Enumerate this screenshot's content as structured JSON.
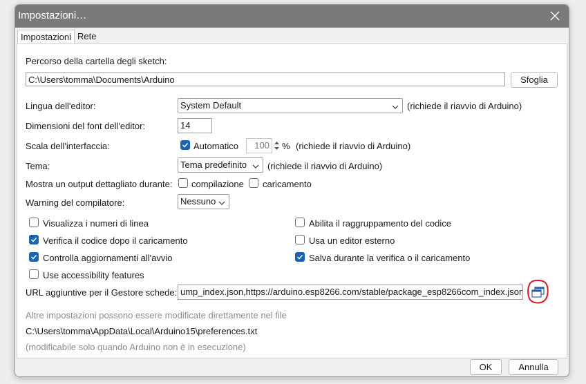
{
  "window": {
    "title": "Impostazioni…"
  },
  "tabs": [
    "Impostazioni",
    "Rete"
  ],
  "sketchbook": {
    "label": "Percorso della cartella degli sketch:",
    "value": "C:\\Users\\tomma\\Documents\\Arduino",
    "browse_label": "Sfoglia"
  },
  "language": {
    "label": "Lingua dell'editor:",
    "selected": "System Default",
    "note": "(richiede il riavvio di Arduino)"
  },
  "font_size": {
    "label": "Dimensioni del font dell'editor:",
    "value": "14"
  },
  "scale": {
    "label": "Scala dell'interfaccia:",
    "auto_label": "Automatico",
    "auto_checked": true,
    "value": "100",
    "unit": "%",
    "note": "(richiede il riavvio di Arduino)"
  },
  "theme": {
    "label": "Tema:",
    "selected": "Tema predefinito",
    "note": "(richiede il riavvio di Arduino)"
  },
  "verbose": {
    "label": "Mostra un output dettagliato durante:",
    "compile_label": "compilazione",
    "compile_checked": false,
    "upload_label": "caricamento",
    "upload_checked": false
  },
  "warnings": {
    "label": "Warning del compilatore:",
    "selected": "Nessuno"
  },
  "options_left": [
    {
      "label": "Visualizza i numeri di linea",
      "checked": false
    },
    {
      "label": "Verifica il codice dopo il caricamento",
      "checked": true
    },
    {
      "label": "Controlla aggiornamenti all'avvio",
      "checked": true
    },
    {
      "label": "Use accessibility features",
      "checked": false
    }
  ],
  "options_right": [
    {
      "label": "Abilita il raggruppamento del codice",
      "checked": false
    },
    {
      "label": "Usa un editor esterno",
      "checked": false
    },
    {
      "label": "Salva durante la verifica o il caricamento",
      "checked": true
    }
  ],
  "board_urls": {
    "label": "URL aggiuntive per il Gestore schede:",
    "value": "ump_index.json,https://arduino.esp8266.com/stable/package_esp8266com_index.json",
    "icon": "open-list-window-icon"
  },
  "info": {
    "more_prefs": "Altre impostazioni possono essere modificate direttamente nel file",
    "path": "C:\\Users\\tomma\\AppData\\Local\\Arduino15\\preferences.txt",
    "note": "(modificabile solo quando Arduino non è in esecuzione)"
  },
  "footer": {
    "ok_label": "OK",
    "cancel_label": "Annulla"
  },
  "colors": {
    "accent": "#1764b8",
    "titlebar": "#7a7a7a",
    "annotation_red": "#e0141e"
  }
}
